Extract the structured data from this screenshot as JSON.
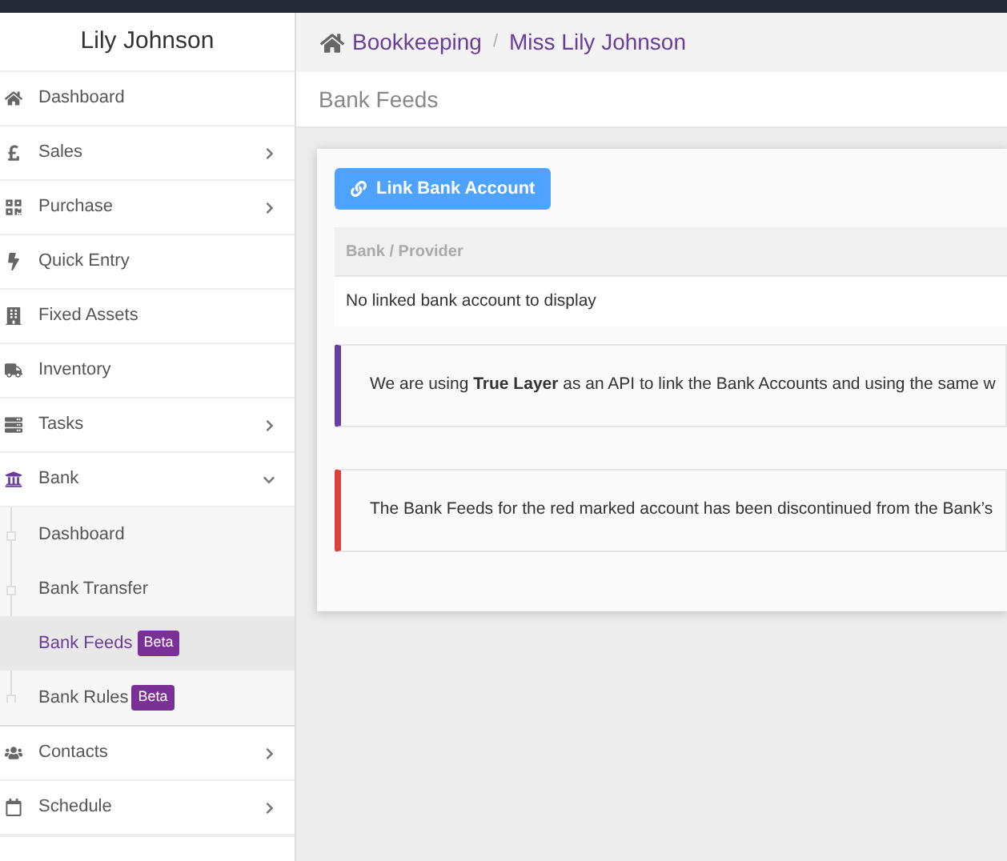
{
  "sidebar": {
    "user_name": "Lily Johnson",
    "items": [
      {
        "label": "Dashboard"
      },
      {
        "label": "Sales",
        "expanded": false
      },
      {
        "label": "Purchase",
        "expanded": false
      },
      {
        "label": "Quick Entry"
      },
      {
        "label": "Fixed Assets"
      },
      {
        "label": "Inventory"
      },
      {
        "label": "Tasks",
        "expanded": false
      },
      {
        "label": "Bank",
        "expanded": true,
        "children": [
          {
            "label": "Dashboard",
            "selected": false
          },
          {
            "label": "Bank Transfer",
            "selected": false
          },
          {
            "label": "Bank Feeds",
            "selected": true,
            "badge": "Beta"
          },
          {
            "label": "Bank Rules",
            "selected": false,
            "badge": "Beta"
          }
        ]
      },
      {
        "label": "Contacts",
        "expanded": false
      },
      {
        "label": "Schedule",
        "expanded": false
      }
    ]
  },
  "breadcrumb": [
    {
      "label": "Bookkeeping"
    },
    {
      "label": "Miss Lily Johnson"
    }
  ],
  "breadcrumb_separator": "/",
  "page_title": "Bank Feeds",
  "link_button": "Link Bank Account",
  "table": {
    "columns": [
      "Bank / Provider"
    ],
    "empty_message": "No linked bank account to display"
  },
  "alerts": [
    {
      "color": "#6a3d9a",
      "text": "We are using **True Layer** as an API to link the Bank Accounts and using the same w"
    },
    {
      "color": "#d9413a",
      "text": "The Bank Feeds for the red marked account has been discontinued from the Bank’s"
    }
  ]
}
